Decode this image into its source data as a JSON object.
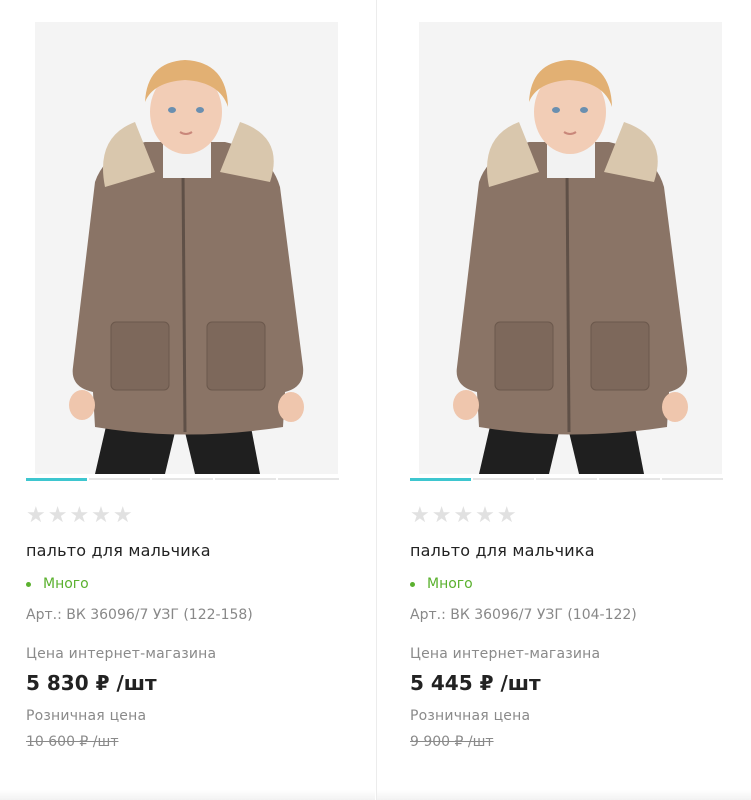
{
  "products": [
    {
      "title": "пальто для мальчика",
      "rating_stars": "★★★★★",
      "stock": "Много",
      "sku": "Арт.: ВК 36096/7 УЗГ (122-158)",
      "price_label": "Цена интернет-магазина",
      "price": "5 830 ₽ /шт",
      "retail_label": "Розничная цена",
      "retail_price": "10 600 ₽ /шт",
      "image_alt": "boy-in-brown-parka-photo"
    },
    {
      "title": "пальто для мальчика",
      "rating_stars": "★★★★★",
      "stock": "Много",
      "sku": "Арт.: ВК 36096/7 УЗГ (104-122)",
      "price_label": "Цена интернет-магазина",
      "price": "5 445 ₽ /шт",
      "retail_label": "Розничная цена",
      "retail_price": "9 900 ₽ /шт",
      "image_alt": "boy-in-brown-parka-photo"
    }
  ],
  "colors": {
    "accent": "#3ec6cf",
    "stock_green": "#5bb12f",
    "coat": "#8a7466",
    "fur": "#d9c7ad",
    "hair": "#e2b073"
  }
}
